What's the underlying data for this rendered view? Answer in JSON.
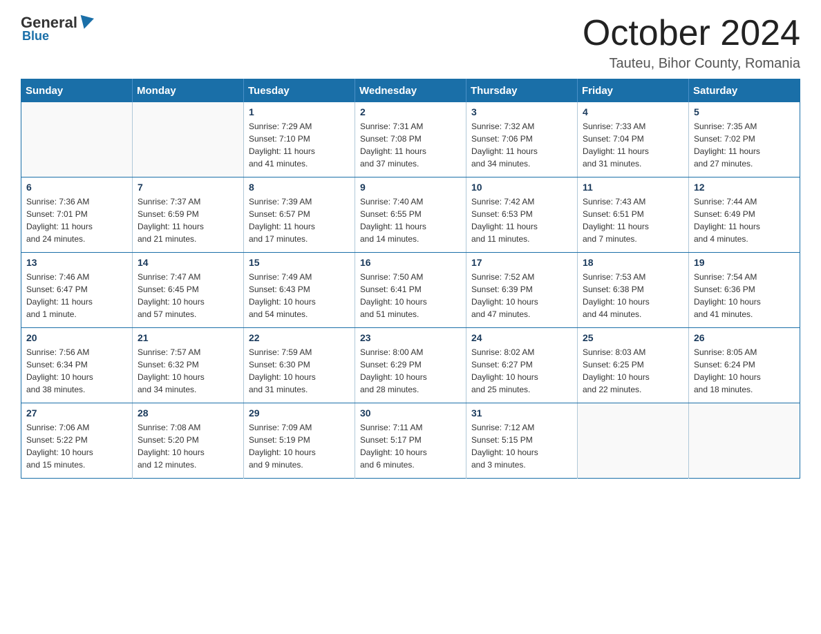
{
  "header": {
    "logo": {
      "general": "General",
      "blue": "Blue"
    },
    "title": "October 2024",
    "location": "Tauteu, Bihor County, Romania"
  },
  "calendar": {
    "weekdays": [
      "Sunday",
      "Monday",
      "Tuesday",
      "Wednesday",
      "Thursday",
      "Friday",
      "Saturday"
    ],
    "weeks": [
      [
        {
          "day": "",
          "info": ""
        },
        {
          "day": "",
          "info": ""
        },
        {
          "day": "1",
          "info": "Sunrise: 7:29 AM\nSunset: 7:10 PM\nDaylight: 11 hours\nand 41 minutes."
        },
        {
          "day": "2",
          "info": "Sunrise: 7:31 AM\nSunset: 7:08 PM\nDaylight: 11 hours\nand 37 minutes."
        },
        {
          "day": "3",
          "info": "Sunrise: 7:32 AM\nSunset: 7:06 PM\nDaylight: 11 hours\nand 34 minutes."
        },
        {
          "day": "4",
          "info": "Sunrise: 7:33 AM\nSunset: 7:04 PM\nDaylight: 11 hours\nand 31 minutes."
        },
        {
          "day": "5",
          "info": "Sunrise: 7:35 AM\nSunset: 7:02 PM\nDaylight: 11 hours\nand 27 minutes."
        }
      ],
      [
        {
          "day": "6",
          "info": "Sunrise: 7:36 AM\nSunset: 7:01 PM\nDaylight: 11 hours\nand 24 minutes."
        },
        {
          "day": "7",
          "info": "Sunrise: 7:37 AM\nSunset: 6:59 PM\nDaylight: 11 hours\nand 21 minutes."
        },
        {
          "day": "8",
          "info": "Sunrise: 7:39 AM\nSunset: 6:57 PM\nDaylight: 11 hours\nand 17 minutes."
        },
        {
          "day": "9",
          "info": "Sunrise: 7:40 AM\nSunset: 6:55 PM\nDaylight: 11 hours\nand 14 minutes."
        },
        {
          "day": "10",
          "info": "Sunrise: 7:42 AM\nSunset: 6:53 PM\nDaylight: 11 hours\nand 11 minutes."
        },
        {
          "day": "11",
          "info": "Sunrise: 7:43 AM\nSunset: 6:51 PM\nDaylight: 11 hours\nand 7 minutes."
        },
        {
          "day": "12",
          "info": "Sunrise: 7:44 AM\nSunset: 6:49 PM\nDaylight: 11 hours\nand 4 minutes."
        }
      ],
      [
        {
          "day": "13",
          "info": "Sunrise: 7:46 AM\nSunset: 6:47 PM\nDaylight: 11 hours\nand 1 minute."
        },
        {
          "day": "14",
          "info": "Sunrise: 7:47 AM\nSunset: 6:45 PM\nDaylight: 10 hours\nand 57 minutes."
        },
        {
          "day": "15",
          "info": "Sunrise: 7:49 AM\nSunset: 6:43 PM\nDaylight: 10 hours\nand 54 minutes."
        },
        {
          "day": "16",
          "info": "Sunrise: 7:50 AM\nSunset: 6:41 PM\nDaylight: 10 hours\nand 51 minutes."
        },
        {
          "day": "17",
          "info": "Sunrise: 7:52 AM\nSunset: 6:39 PM\nDaylight: 10 hours\nand 47 minutes."
        },
        {
          "day": "18",
          "info": "Sunrise: 7:53 AM\nSunset: 6:38 PM\nDaylight: 10 hours\nand 44 minutes."
        },
        {
          "day": "19",
          "info": "Sunrise: 7:54 AM\nSunset: 6:36 PM\nDaylight: 10 hours\nand 41 minutes."
        }
      ],
      [
        {
          "day": "20",
          "info": "Sunrise: 7:56 AM\nSunset: 6:34 PM\nDaylight: 10 hours\nand 38 minutes."
        },
        {
          "day": "21",
          "info": "Sunrise: 7:57 AM\nSunset: 6:32 PM\nDaylight: 10 hours\nand 34 minutes."
        },
        {
          "day": "22",
          "info": "Sunrise: 7:59 AM\nSunset: 6:30 PM\nDaylight: 10 hours\nand 31 minutes."
        },
        {
          "day": "23",
          "info": "Sunrise: 8:00 AM\nSunset: 6:29 PM\nDaylight: 10 hours\nand 28 minutes."
        },
        {
          "day": "24",
          "info": "Sunrise: 8:02 AM\nSunset: 6:27 PM\nDaylight: 10 hours\nand 25 minutes."
        },
        {
          "day": "25",
          "info": "Sunrise: 8:03 AM\nSunset: 6:25 PM\nDaylight: 10 hours\nand 22 minutes."
        },
        {
          "day": "26",
          "info": "Sunrise: 8:05 AM\nSunset: 6:24 PM\nDaylight: 10 hours\nand 18 minutes."
        }
      ],
      [
        {
          "day": "27",
          "info": "Sunrise: 7:06 AM\nSunset: 5:22 PM\nDaylight: 10 hours\nand 15 minutes."
        },
        {
          "day": "28",
          "info": "Sunrise: 7:08 AM\nSunset: 5:20 PM\nDaylight: 10 hours\nand 12 minutes."
        },
        {
          "day": "29",
          "info": "Sunrise: 7:09 AM\nSunset: 5:19 PM\nDaylight: 10 hours\nand 9 minutes."
        },
        {
          "day": "30",
          "info": "Sunrise: 7:11 AM\nSunset: 5:17 PM\nDaylight: 10 hours\nand 6 minutes."
        },
        {
          "day": "31",
          "info": "Sunrise: 7:12 AM\nSunset: 5:15 PM\nDaylight: 10 hours\nand 3 minutes."
        },
        {
          "day": "",
          "info": ""
        },
        {
          "day": "",
          "info": ""
        }
      ]
    ]
  }
}
